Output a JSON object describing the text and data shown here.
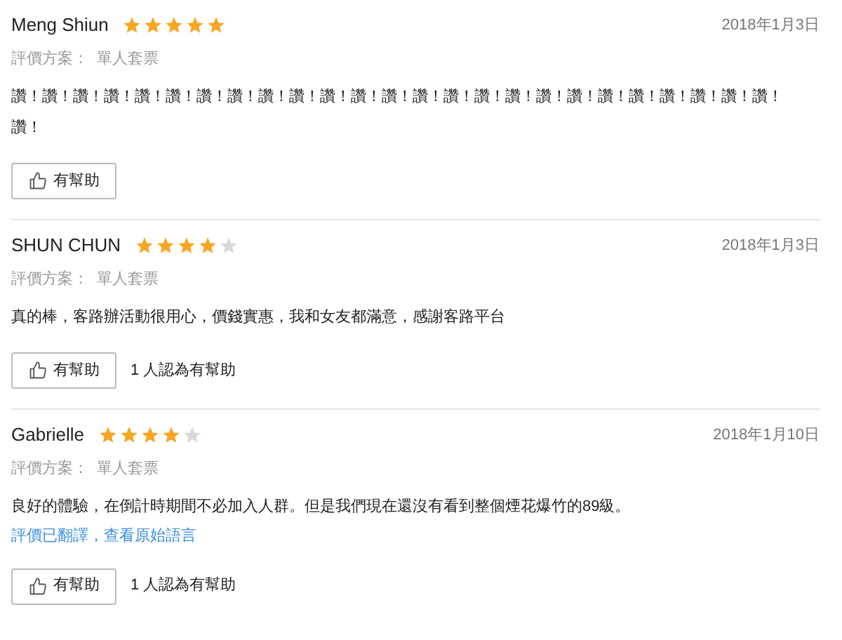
{
  "reviews": [
    {
      "name": "Meng Shiun",
      "stars": 5,
      "date": "2018年1月3日",
      "plan_label": "評價方案：",
      "plan": "單人套票",
      "text": "讚！讚！讚！讚！讚！讚！讚！讚！讚！讚！讚！讚！讚！讚！讚！讚！讚！讚！讚！讚！讚！讚！讚！讚！讚！讚！",
      "helpful_button": "有幫助"
    },
    {
      "name": "SHUN CHUN",
      "stars": 4,
      "date": "2018年1月3日",
      "plan_label": "評價方案：",
      "plan": "單人套票",
      "text": "真的棒，客路辦活動很用心，價錢實惠，我和女友都滿意，感謝客路平台",
      "helpful_button": "有幫助",
      "helpful_count": "1 人認為有幫助"
    },
    {
      "name": "Gabrielle",
      "stars": 4,
      "date": "2018年1月10日",
      "plan_label": "評價方案：",
      "plan": "單人套票",
      "text": "良好的體驗，在倒計時期間不必加入人群。但是我們現在還沒有看到整個煙花爆竹的89級。",
      "translation_note": "評價已翻譯，查看原始語言",
      "helpful_button": "有幫助",
      "helpful_count": "1 人認為有幫助"
    }
  ]
}
